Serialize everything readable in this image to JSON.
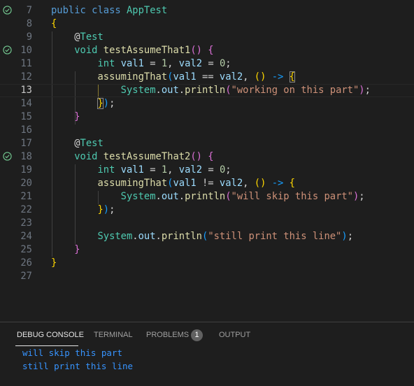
{
  "editor": {
    "current_line": 13,
    "lines": [
      {
        "no": "7",
        "test_passed": true,
        "tokens": [
          [
            "public class ",
            "k"
          ],
          [
            "AppTest",
            "t"
          ]
        ]
      },
      {
        "no": "8",
        "tokens": [
          [
            "{",
            "b1"
          ]
        ]
      },
      {
        "no": "9",
        "tokens": [
          [
            "    @",
            "p"
          ],
          [
            "Test",
            "t"
          ]
        ]
      },
      {
        "no": "10",
        "test_passed": true,
        "tokens": [
          [
            "    void ",
            "t"
          ],
          [
            "testAssumeThat1",
            "f"
          ],
          [
            "() {",
            "b2"
          ]
        ]
      },
      {
        "no": "11",
        "tokens": [
          [
            "        int ",
            "t"
          ],
          [
            "val1",
            "v"
          ],
          [
            " = ",
            "p"
          ],
          [
            "1",
            "n"
          ],
          [
            ", ",
            "p"
          ],
          [
            "val2",
            "v"
          ],
          [
            " = ",
            "p"
          ],
          [
            "0",
            "n"
          ],
          [
            ";",
            "p"
          ]
        ]
      },
      {
        "no": "12",
        "tokens": [
          [
            "        assumingThat",
            "f"
          ],
          [
            "(",
            "b3"
          ],
          [
            "val1",
            "v"
          ],
          [
            " == ",
            "p"
          ],
          [
            "val2",
            "v"
          ],
          [
            ", ",
            "p"
          ],
          [
            "()",
            "b1"
          ],
          [
            " -> ",
            "b3"
          ],
          [
            "{",
            "b1 m"
          ]
        ]
      },
      {
        "no": "13",
        "tokens": [
          [
            "            System",
            "t"
          ],
          [
            ".",
            "p"
          ],
          [
            "out",
            "v"
          ],
          [
            ".",
            "p"
          ],
          [
            "println",
            "f"
          ],
          [
            "(",
            "b2"
          ],
          [
            "\"working on this part\"",
            "s"
          ],
          [
            ")",
            "b2"
          ],
          [
            ";",
            "p"
          ]
        ]
      },
      {
        "no": "14",
        "tokens": [
          [
            "        ",
            "p"
          ],
          [
            "}",
            "b1 m"
          ],
          [
            ")",
            "b3"
          ],
          [
            ";",
            "p"
          ]
        ]
      },
      {
        "no": "15",
        "tokens": [
          [
            "    }",
            "b2"
          ]
        ]
      },
      {
        "no": "16",
        "tokens": []
      },
      {
        "no": "17",
        "tokens": [
          [
            "    @",
            "p"
          ],
          [
            "Test",
            "t"
          ]
        ]
      },
      {
        "no": "18",
        "test_passed": true,
        "tokens": [
          [
            "    void ",
            "t"
          ],
          [
            "testAssumeThat2",
            "f"
          ],
          [
            "() {",
            "b2"
          ]
        ]
      },
      {
        "no": "19",
        "tokens": [
          [
            "        int ",
            "t"
          ],
          [
            "val1",
            "v"
          ],
          [
            " = ",
            "p"
          ],
          [
            "1",
            "n"
          ],
          [
            ", ",
            "p"
          ],
          [
            "val2",
            "v"
          ],
          [
            " = ",
            "p"
          ],
          [
            "0",
            "n"
          ],
          [
            ";",
            "p"
          ]
        ]
      },
      {
        "no": "20",
        "tokens": [
          [
            "        assumingThat",
            "f"
          ],
          [
            "(",
            "b3"
          ],
          [
            "val1",
            "v"
          ],
          [
            " != ",
            "p"
          ],
          [
            "val2",
            "v"
          ],
          [
            ", ",
            "p"
          ],
          [
            "()",
            "b1"
          ],
          [
            " -> ",
            "b3"
          ],
          [
            "{",
            "b1"
          ]
        ]
      },
      {
        "no": "21",
        "tokens": [
          [
            "            System",
            "t"
          ],
          [
            ".",
            "p"
          ],
          [
            "out",
            "v"
          ],
          [
            ".",
            "p"
          ],
          [
            "println",
            "f"
          ],
          [
            "(",
            "b2"
          ],
          [
            "\"will skip this part\"",
            "s"
          ],
          [
            ")",
            "b2"
          ],
          [
            ";",
            "p"
          ]
        ]
      },
      {
        "no": "22",
        "tokens": [
          [
            "        }",
            "b1"
          ],
          [
            ")",
            "b3"
          ],
          [
            ";",
            "p"
          ]
        ]
      },
      {
        "no": "23",
        "tokens": []
      },
      {
        "no": "24",
        "tokens": [
          [
            "        System",
            "t"
          ],
          [
            ".",
            "p"
          ],
          [
            "out",
            "v"
          ],
          [
            ".",
            "p"
          ],
          [
            "println",
            "f"
          ],
          [
            "(",
            "b3"
          ],
          [
            "\"still print this line\"",
            "s"
          ],
          [
            ")",
            "b3"
          ],
          [
            ";",
            "p"
          ]
        ]
      },
      {
        "no": "25",
        "tokens": [
          [
            "    }",
            "b2"
          ]
        ]
      },
      {
        "no": "26",
        "tokens": [
          [
            "}",
            "b1"
          ]
        ]
      },
      {
        "no": "27",
        "tokens": []
      }
    ]
  },
  "panel": {
    "tabs": [
      {
        "label": "DEBUG CONSOLE",
        "active": true
      },
      {
        "label": "TERMINAL"
      },
      {
        "label": "PROBLEMS",
        "badge": "1"
      },
      {
        "label": "OUTPUT"
      }
    ],
    "output": [
      "will skip this part",
      "still print this line"
    ]
  },
  "colors": {
    "background": "#1e1e1e",
    "test_passed": "#73c991",
    "console_output": "#3794ff"
  },
  "icons": {
    "test_passed": "check-circle-icon"
  }
}
